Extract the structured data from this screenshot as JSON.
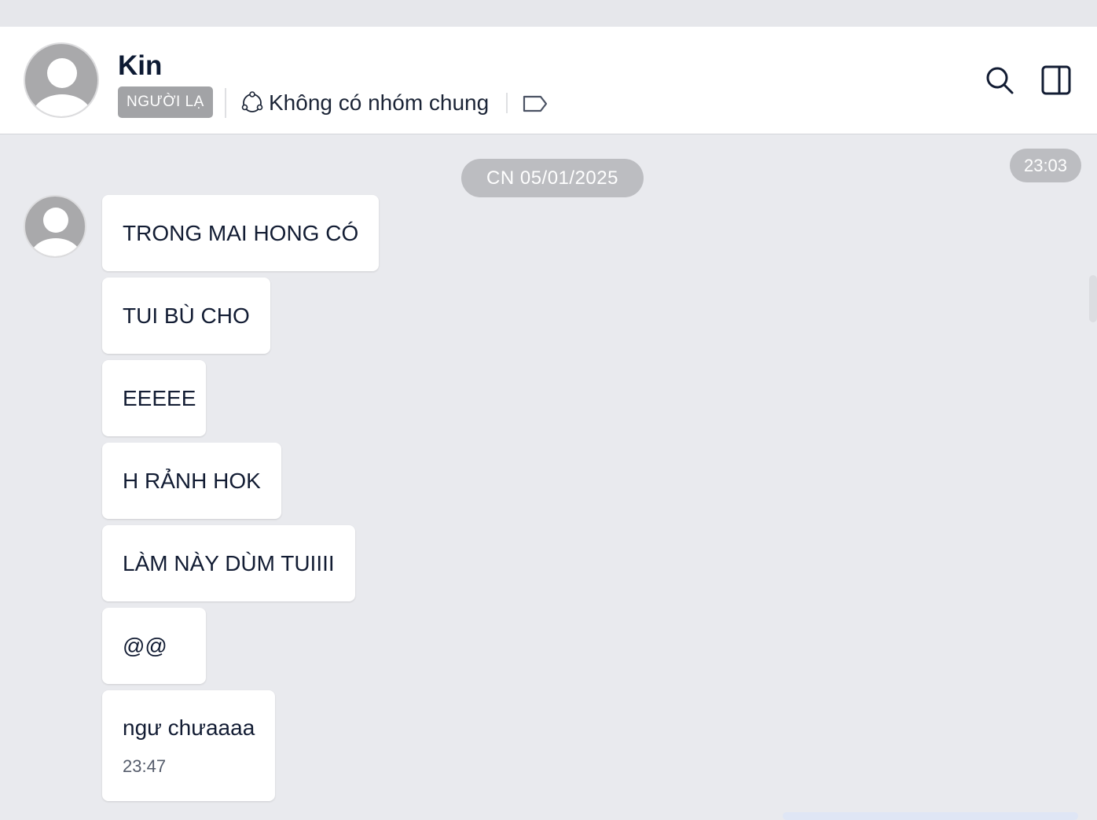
{
  "header": {
    "contact_name": "Kin",
    "stranger_badge": "NGƯỜI LẠ",
    "group_info": "Không có nhóm chung",
    "icons": [
      "avatar",
      "group-icon",
      "tag-icon",
      "search-icon",
      "panel-toggle-icon"
    ]
  },
  "conversation": {
    "date_separator": "CN 05/01/2025",
    "time_marker": "23:03",
    "messages": [
      {
        "text": "TRONG MAI HONG CÓ"
      },
      {
        "text": "TUI BÙ CHO"
      },
      {
        "text": "EEEEE"
      },
      {
        "text": "H RẢNH HOK"
      },
      {
        "text": "LÀM NÀY DÙM TUIIII"
      },
      {
        "text": "@@"
      },
      {
        "text": "ngư chưaaaa",
        "time": "23:47"
      }
    ]
  },
  "colors": {
    "background": "#e9eaee",
    "header_bg": "#ffffff",
    "bubble_bg": "#ffffff",
    "badge_bg": "#a2a3a6",
    "pill_bg": "#bcbdc1",
    "text": "#121c33"
  }
}
